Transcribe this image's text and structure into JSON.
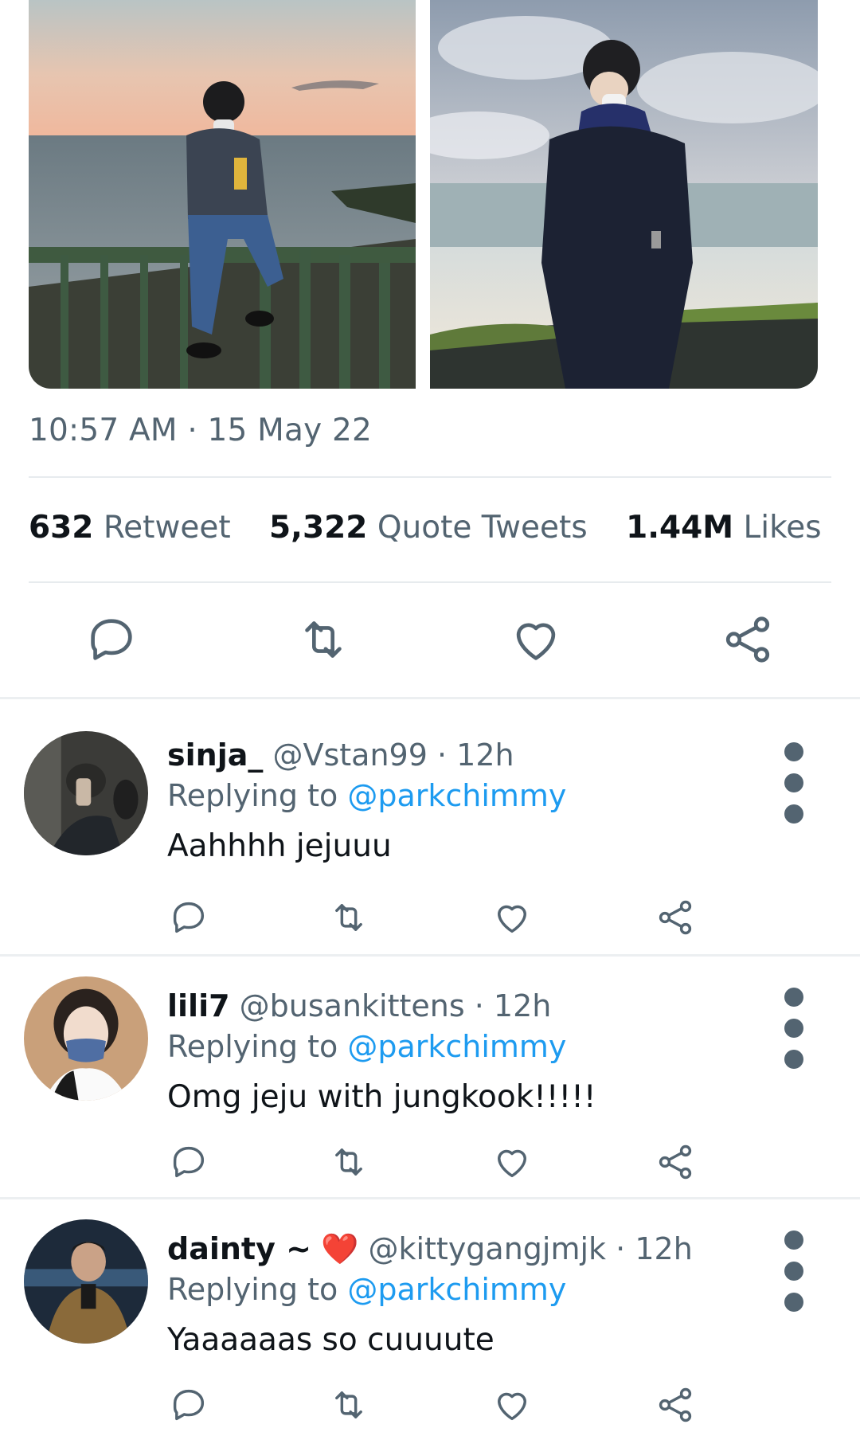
{
  "tweet": {
    "timestamp": "10:57 AM · 15 May 22",
    "stats": [
      {
        "count": "632",
        "label": "Retweet"
      },
      {
        "count": "5,322",
        "label": "Quote Tweets"
      },
      {
        "count": "1.44M",
        "label": "Likes"
      }
    ],
    "actions": [
      "reply-icon",
      "retweet-icon",
      "like-icon",
      "share-icon"
    ]
  },
  "replies": [
    {
      "name": "sinja_",
      "handle": "@Vstan99",
      "time": "12h",
      "replying_label": "Replying to",
      "replying_to": "@parkchimmy",
      "text": "Aahhhh jejuuu"
    },
    {
      "name": "lili7",
      "handle": "@busankittens",
      "time": "12h",
      "replying_label": "Replying to",
      "replying_to": "@parkchimmy",
      "text": "Omg jeju with jungkook!!!!!"
    },
    {
      "name": "dainty ~",
      "name_emoji": "❤️",
      "handle": "@kittygangjmjk",
      "time": "12h",
      "replying_label": "Replying to",
      "replying_to": "@parkchimmy",
      "text": "Yaaaaaas so cuuuute"
    }
  ],
  "colors": {
    "secondary_text": "#536471",
    "link": "#1d9bf0",
    "divider": "#e7ebee"
  }
}
